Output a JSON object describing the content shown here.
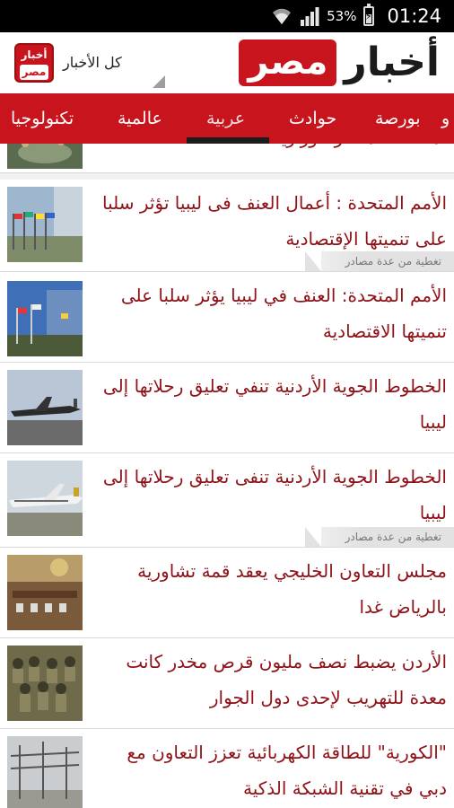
{
  "status_bar": {
    "battery_percent": "53%",
    "time": "01:24"
  },
  "header": {
    "logo_word": "أخبار",
    "logo_box_word": "مصر",
    "small_logo_line1": "أخبار",
    "small_logo_line2": "مصر",
    "all_news_label": "كل الأخبار"
  },
  "tabs": [
    {
      "label": "تكنولوجيا",
      "active": false
    },
    {
      "label": "عالمية",
      "active": false
    },
    {
      "label": "عربية",
      "active": true
    },
    {
      "label": "حوادث",
      "active": false
    },
    {
      "label": "بورصة",
      "active": false
    },
    {
      "label": "و",
      "active": false
    }
  ],
  "partial_item": {
    "headline": "لمنطقة المشتر الوزارية"
  },
  "articles": [
    {
      "line1": "الأمم المتحدة : أعمال العنف فى ليبيا تؤثر سلبا",
      "line2": "على تنميتها الإقتصادية",
      "coverage": "تغطية من عدة مصادر"
    },
    {
      "line1": "الأمم المتحدة: العنف في ليبيا يؤثر سلبا على",
      "line2": "تنميتها الاقتصادية",
      "coverage": ""
    },
    {
      "line1": "الخطوط الجوية الأردنية تنفي تعليق رحلاتها إلى",
      "line2": "ليبيا",
      "coverage": ""
    },
    {
      "line1": "الخطوط الجوية الأردنية تنفى تعليق رحلاتها إلى",
      "line2": "ليبيا",
      "coverage": "تغطية من عدة مصادر"
    },
    {
      "line1": "مجلس التعاون الخليجي يعقد قمة تشاورية",
      "line2": "بالرياض غدا",
      "coverage": ""
    },
    {
      "line1": "الأردن يضبط نصف مليون قرص مخدر كانت",
      "line2": "معدة للتهريب لإحدى دول الجوار",
      "coverage": ""
    },
    {
      "line1": "\"الكورية\" للطاقة الكهربائية تعزز التعاون مع",
      "line2": "دبي في تقنية الشبكة الذكية",
      "coverage": ""
    }
  ],
  "colors": {
    "brand_red": "#c8141c",
    "headline_red": "#8f1218"
  }
}
